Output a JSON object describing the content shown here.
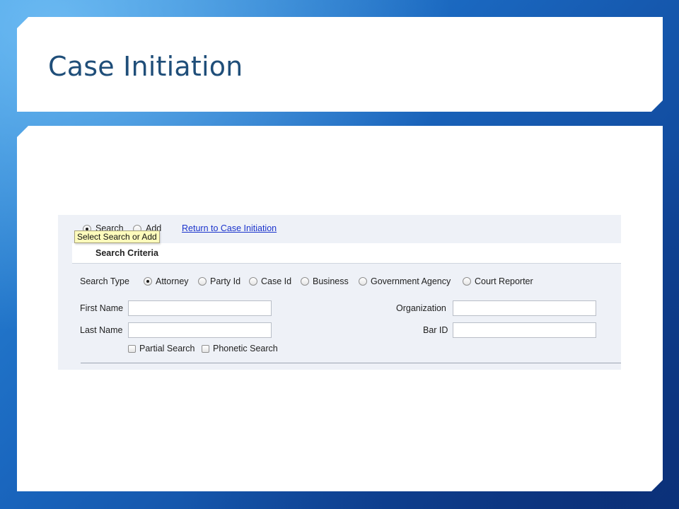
{
  "slide": {
    "title": "Case Initiation"
  },
  "app": {
    "mode_options": {
      "search": "Search",
      "add": "Add",
      "selected": "search"
    },
    "return_link": "Return to Case Initiation",
    "tooltip": "Select Search or Add",
    "section_title": "Search Criteria",
    "search_type": {
      "label": "Search Type",
      "options": [
        "Attorney",
        "Party Id",
        "Case Id",
        "Business",
        "Government Agency",
        "Court Reporter"
      ],
      "selected": "Attorney"
    },
    "fields": {
      "first_name": {
        "label": "First Name",
        "value": ""
      },
      "last_name": {
        "label": "Last Name",
        "value": ""
      },
      "organization": {
        "label": "Organization",
        "value": ""
      },
      "bar_id": {
        "label": "Bar ID",
        "value": ""
      }
    },
    "checkboxes": {
      "partial_search": {
        "label": "Partial Search",
        "checked": false
      },
      "phonetic_search": {
        "label": "Phonetic Search",
        "checked": false
      }
    }
  },
  "colors": {
    "title_text": "#1f4e79",
    "link": "#1a33cc",
    "tooltip_bg": "#fdfbbc",
    "form_bg": "#eef1f7"
  }
}
